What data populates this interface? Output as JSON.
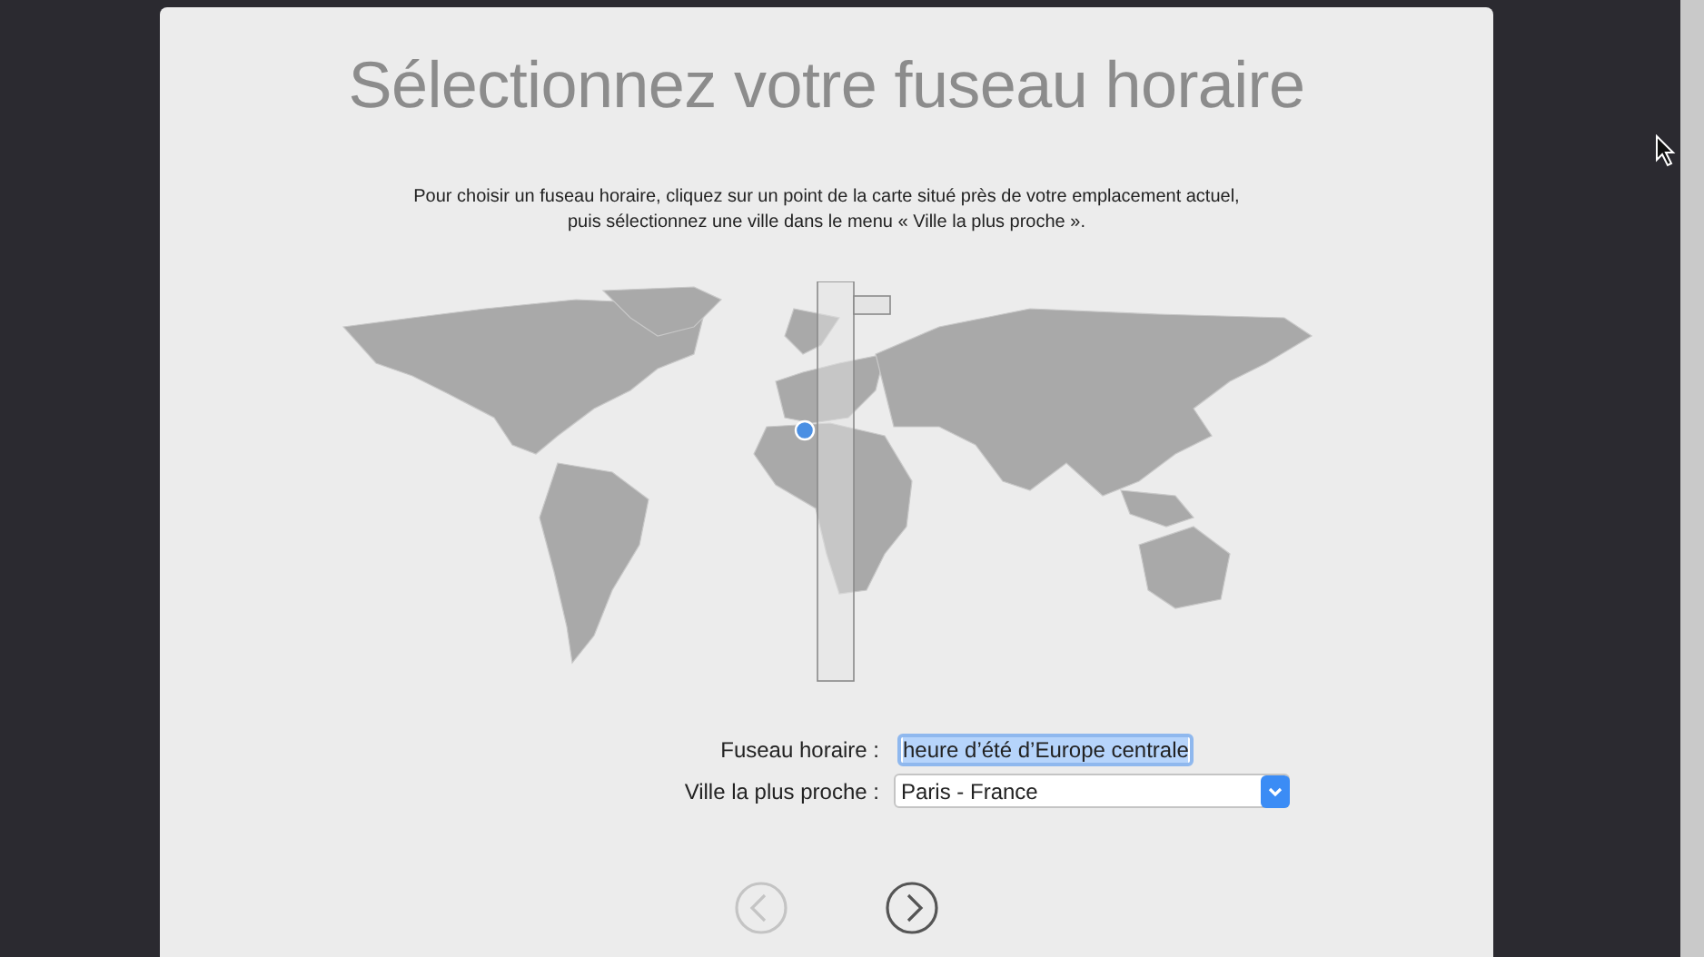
{
  "title": "Sélectionnez votre fuseau horaire",
  "instructions": "Pour choisir un fuseau horaire, cliquez sur un point de la carte situé près de votre emplacement actuel,\npuis sélectionnez une ville dans le menu « Ville la plus proche ».",
  "form": [
    {
      "kind": "text",
      "label": "Fuseau horaire :",
      "value": "heure d’été d’Europe centrale",
      "selected": true
    },
    {
      "kind": "dropdown",
      "label": "Ville la plus proche :",
      "value": "Paris - France"
    }
  ],
  "navigation": [
    {
      "kind": "back",
      "disabled": true
    },
    {
      "kind": "next",
      "disabled": false
    }
  ]
}
